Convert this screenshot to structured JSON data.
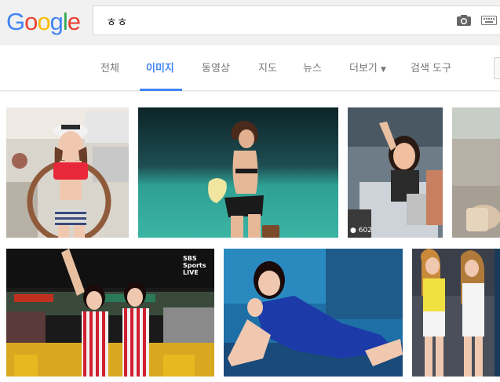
{
  "header": {
    "logo": [
      "G",
      "o",
      "o",
      "g",
      "l",
      "e"
    ],
    "logo_colors": [
      "#4285f4",
      "#ea4335",
      "#fbbc05",
      "#4285f4",
      "#34a853",
      "#ea4335"
    ],
    "search_value": "ㅎㅎ",
    "camera_icon": "camera-icon",
    "keyboard_icon": "keyboard-icon"
  },
  "tabs": [
    {
      "label": "전체"
    },
    {
      "label": "이미지",
      "active": true
    },
    {
      "label": "동영상"
    },
    {
      "label": "지도"
    },
    {
      "label": "뉴스"
    },
    {
      "label": "더보기"
    },
    {
      "label": "검색 도구"
    }
  ],
  "accent_color": "#4285f4",
  "results": {
    "thumb_badge": "602",
    "thumb_overlay_text": "SBS Sports LIVE"
  }
}
